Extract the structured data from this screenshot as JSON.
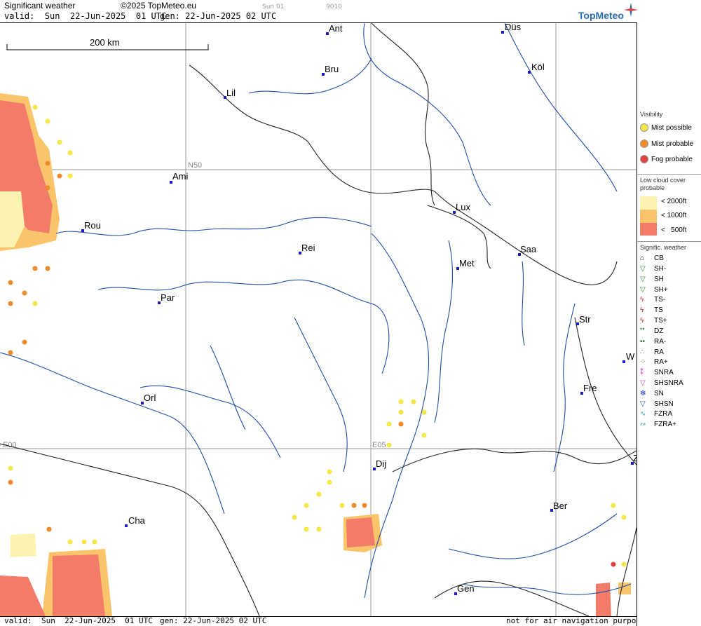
{
  "header": {
    "title": "Significant weather",
    "copyright": "©2025 TopMeteo.eu",
    "valid_line": "valid:  Sun  22-Jun-2025  01 UTC",
    "gen_line": "gen: 22-Jun-2025 02 UTC",
    "small_day": "Sun 01",
    "small_code": "9010",
    "logo": "TopMeteo"
  },
  "scale": {
    "label": "200 km"
  },
  "grid_labels": {
    "n50": "N50",
    "e00": "E00",
    "e05": "E05"
  },
  "cities": [
    {
      "label": "Ant"
    },
    {
      "label": "Düs"
    },
    {
      "label": "Bru"
    },
    {
      "label": "Köl"
    },
    {
      "label": "Lil"
    },
    {
      "label": "Ami"
    },
    {
      "label": "Rou"
    },
    {
      "label": "Lux"
    },
    {
      "label": "Saa"
    },
    {
      "label": "Rei"
    },
    {
      "label": "Met"
    },
    {
      "label": "Par"
    },
    {
      "label": "Str"
    },
    {
      "label": "W"
    },
    {
      "label": "Fre"
    },
    {
      "label": "Orl"
    },
    {
      "label": "Dij"
    },
    {
      "label": "Z"
    },
    {
      "label": "Ber"
    },
    {
      "label": "Cha"
    },
    {
      "label": "Gen"
    }
  ],
  "footer": {
    "valid": "valid:  Sun  22-Jun-2025  01 UTC",
    "gen": "gen: 22-Jun-2025 02 UTC",
    "note": "not for air navigation purposes"
  },
  "legend": {
    "visibility_title": "Visibility",
    "mist_possible": "Mist possible",
    "mist_probable": "Mist probable",
    "fog_probable": "Fog probable",
    "low_cloud_title_1": "Low cloud cover",
    "low_cloud_title_2": "probable",
    "lc_2000": "< 2000ft",
    "lc_1000": "< 1000ft",
    "lc_500": "<   500ft",
    "sigwx_title": "Signific. weather",
    "items": [
      "CB",
      "SH-",
      "SH",
      "SH+",
      "TS-",
      "TS",
      "TS+",
      "DZ",
      "RA-",
      "RA",
      "RA+",
      "SNRA",
      "SHSNRA",
      "SN",
      "SHSN",
      "FZRA",
      "FZRA+"
    ]
  },
  "colors": {
    "mist_possible": "#f5e64a",
    "mist_probable": "#f08a2a",
    "fog_probable": "#e04040",
    "lc_2000": "#fdf3b0",
    "lc_1000": "#f9c46a",
    "lc_500": "#f27b6a",
    "river": "#1f4ea8",
    "border": "#222222",
    "city": "#1a1ac8"
  }
}
